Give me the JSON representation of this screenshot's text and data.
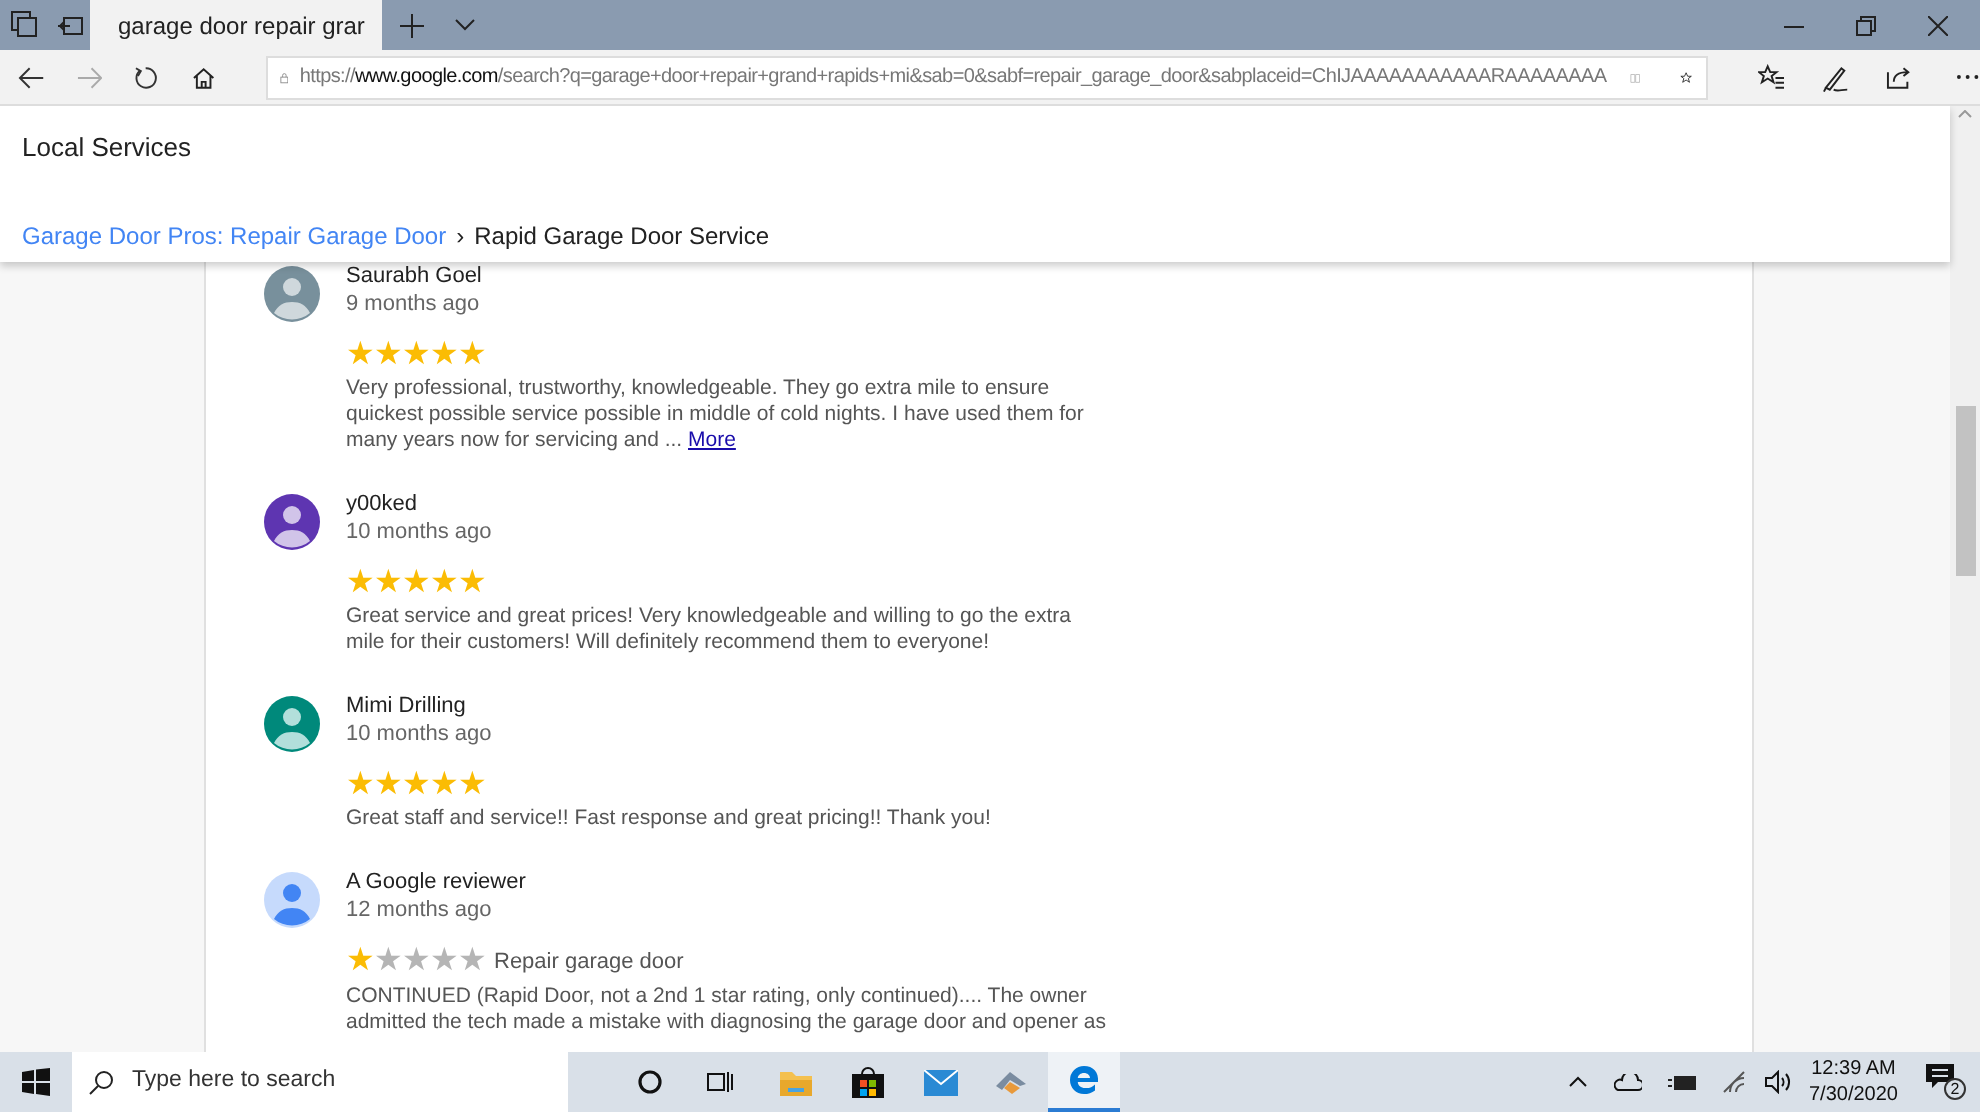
{
  "browser": {
    "tab_title": "garage door repair grar",
    "url_prefix": "https://",
    "url_domain": "www.google.com",
    "url_rest": "/search?q=garage+door+repair+grand+rapids+mi&sab=0&sabf=repair_garage_door&sabplaceid=ChIJAAAAAAAAAAARAAAAAAAA"
  },
  "header": {
    "title": "Local Services",
    "breadcrumb_link": "Garage Door Pros: Repair Garage Door",
    "breadcrumb_separator": "›",
    "breadcrumb_current": "Rapid Garage Door Service"
  },
  "reviews": [
    {
      "name": "Saurabh Goel",
      "time": "9 months ago",
      "stars": 5,
      "avatar": {
        "color": "#78909c",
        "figure": {
          "color": "#cfd8dc"
        }
      },
      "text": "Very professional, trustworthy, knowledgeable. They go extra mile to ensure quickest possible service possible in middle of cold nights. I have used them for many years now for servicing and ...",
      "more": "More"
    },
    {
      "name": "y00ked",
      "time": "10 months ago",
      "stars": 5,
      "avatar": {
        "color": "#5e35b1",
        "figure": {
          "color": "#d1c4e9"
        }
      },
      "text": "Great service and great prices! Very knowledgeable and willing to go the extra mile for their customers! Will definitely recommend them to everyone!"
    },
    {
      "name": "Mimi Drilling",
      "time": "10 months ago",
      "stars": 5,
      "avatar": {
        "color": "#00897b",
        "figure": {
          "color": "#b2dfdb"
        }
      },
      "text": "Great staff and service!! Fast response and great pricing!! Thank you!"
    },
    {
      "name": "A Google reviewer",
      "time": "12 months ago",
      "stars": 1,
      "avatar": {
        "color": "#c6dafc",
        "figure": {
          "color": "#4285f4"
        }
      },
      "tag": "Repair garage door",
      "text": "CONTINUED (Rapid Door, not a 2nd 1 star rating, only continued).... The owner admitted the tech made a mistake with diagnosing the garage door and opener as"
    }
  ],
  "taskbar": {
    "search_placeholder": "Type here to search",
    "time": "12:39 AM",
    "date": "7/30/2020",
    "notifications": "2"
  }
}
